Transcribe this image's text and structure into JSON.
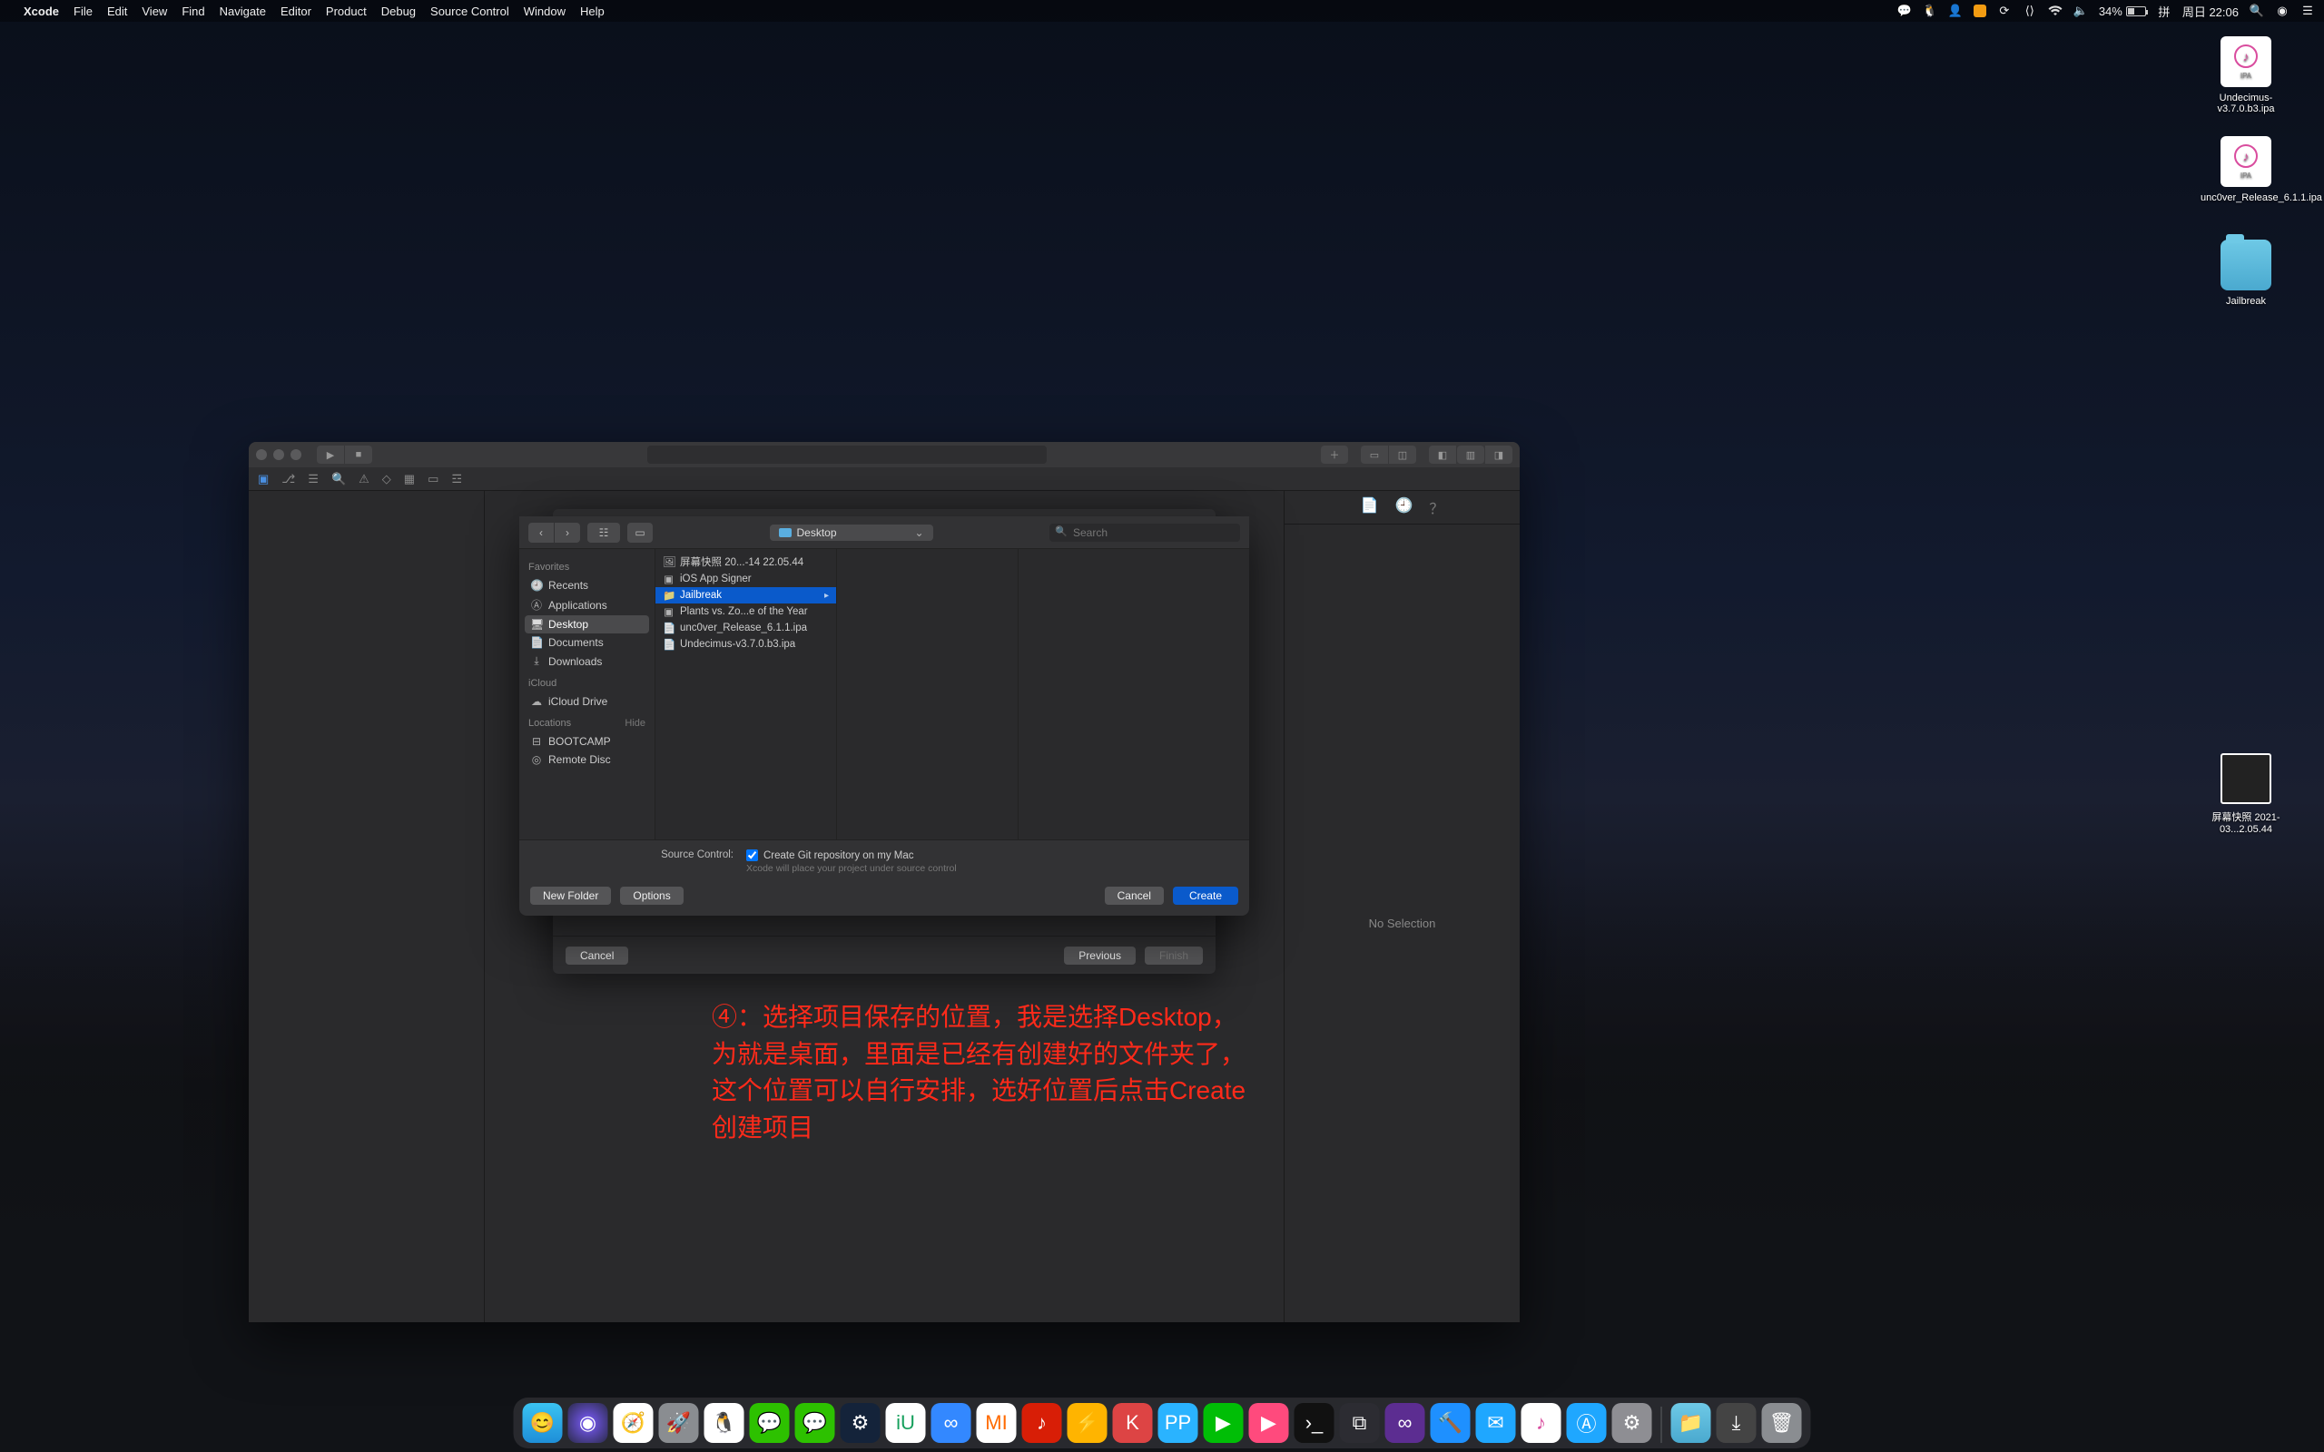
{
  "menubar": {
    "app": "Xcode",
    "items": [
      "File",
      "Edit",
      "View",
      "Find",
      "Navigate",
      "Editor",
      "Product",
      "Debug",
      "Source Control",
      "Window",
      "Help"
    ],
    "battery_pct": "34%",
    "clock": "周日 22:06"
  },
  "desktop": {
    "icons": [
      {
        "name": "Undecimus-v3.7.0.b3.ipa",
        "kind": "ipa"
      },
      {
        "name": "unc0ver_Release_6.1.1.ipa",
        "kind": "ipa"
      },
      {
        "name": "Jailbreak",
        "kind": "folder"
      },
      {
        "name": "屏幕快照 2021-03...2.05.44",
        "kind": "screenshot"
      }
    ]
  },
  "xcode": {
    "inspector_empty": "No Selection",
    "wizard": {
      "cancel": "Cancel",
      "previous": "Previous",
      "finish": "Finish"
    }
  },
  "savesheet": {
    "location": "Desktop",
    "search_placeholder": "Search",
    "sidebar": {
      "favorites_label": "Favorites",
      "favorites": [
        "Recents",
        "Applications",
        "Desktop",
        "Documents",
        "Downloads"
      ],
      "icloud_label": "iCloud",
      "icloud": [
        "iCloud Drive"
      ],
      "locations_label": "Locations",
      "locations_hide": "Hide",
      "locations": [
        "BOOTCAMP",
        "Remote Disc"
      ]
    },
    "column1": [
      {
        "name": "屏幕快照 20...-14 22.05.44",
        "icon": "img"
      },
      {
        "name": "iOS App Signer",
        "icon": "app"
      },
      {
        "name": "Jailbreak",
        "icon": "folder",
        "selected": true,
        "arrow": true
      },
      {
        "name": "Plants vs. Zo...e of the Year",
        "icon": "app"
      },
      {
        "name": "unc0ver_Release_6.1.1.ipa",
        "icon": "file"
      },
      {
        "name": "Undecimus-v3.7.0.b3.ipa",
        "icon": "file"
      }
    ],
    "source_control_label": "Source Control:",
    "git_checkbox": "Create Git repository on my Mac",
    "git_hint": "Xcode will place your project under source control",
    "new_folder": "New Folder",
    "options": "Options",
    "cancel": "Cancel",
    "create": "Create"
  },
  "annotation": {
    "text": "④：选择项目保存的位置，我是选择Desktop，\n为就是桌面，里面是已经有创建好的文件夹了，\n这个位置可以自行安排，选好位置后点击Create\n创建项目"
  },
  "dock": {
    "apps": [
      "finder",
      "siri",
      "safari",
      "launchpad",
      "qq",
      "wechat",
      "wechat2",
      "steam",
      "iu",
      "baidu",
      "mi",
      "netease",
      "thunder",
      "ku",
      "pp",
      "iqiyi",
      "youku",
      "term",
      "vscode",
      "vs",
      "xcode",
      "mail",
      "itunes",
      "appstore",
      "prefs"
    ],
    "tray": [
      "folder",
      "downloads",
      "trash"
    ]
  },
  "colors": {
    "accent": "#0a5acb",
    "annotation": "#ff2a1a"
  }
}
